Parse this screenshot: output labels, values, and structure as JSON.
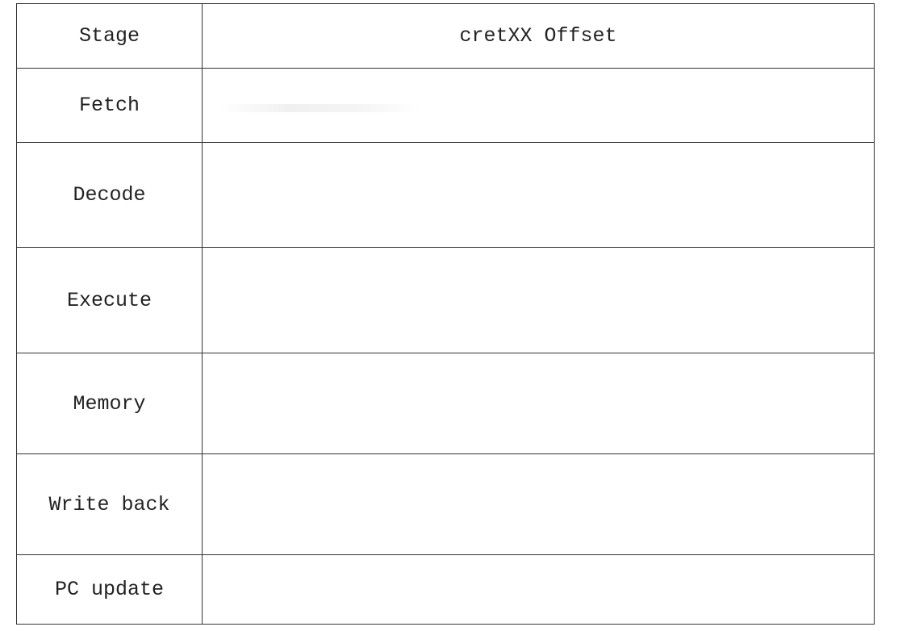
{
  "table": {
    "header": {
      "stage": "Stage",
      "offset": "cretXX Offset"
    },
    "rows": [
      {
        "stage": "Fetch",
        "value": ""
      },
      {
        "stage": "Decode",
        "value": ""
      },
      {
        "stage": "Execute",
        "value": ""
      },
      {
        "stage": "Memory",
        "value": ""
      },
      {
        "stage": "Write back",
        "value": ""
      },
      {
        "stage": "PC update",
        "value": ""
      }
    ]
  }
}
